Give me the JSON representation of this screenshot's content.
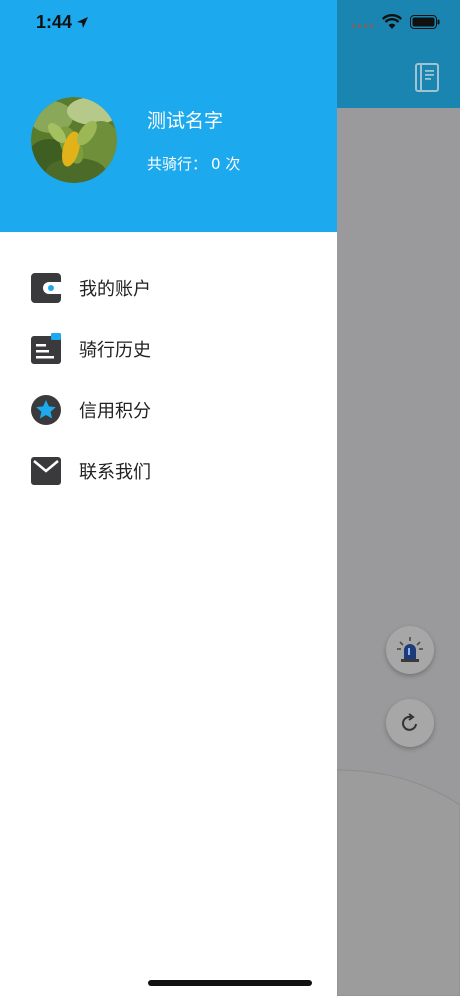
{
  "status_bar": {
    "time": "1:44"
  },
  "profile": {
    "name": "测试名字",
    "ride_count_label": "共骑行：",
    "ride_count_value": "0 次"
  },
  "menu": [
    {
      "label": "我的账户",
      "icon": "wallet-icon"
    },
    {
      "label": "骑行历史",
      "icon": "history-icon"
    },
    {
      "label": "信用积分",
      "icon": "star-icon"
    },
    {
      "label": "联系我们",
      "icon": "mail-icon"
    }
  ],
  "colors": {
    "drawer_header": "#1ca9ee",
    "accent": "#1ca9ee",
    "icon_dark": "#3a3a3c"
  }
}
